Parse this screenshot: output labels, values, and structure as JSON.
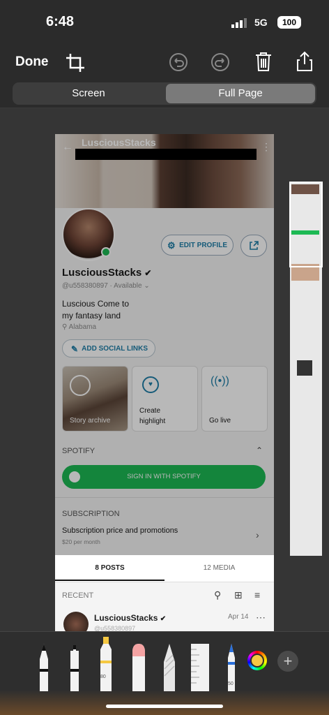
{
  "status": {
    "time": "6:48",
    "network": "5G",
    "battery": "100"
  },
  "toolbar": {
    "done_label": "Done"
  },
  "segment": {
    "screen_label": "Screen",
    "full_page_label": "Full Page"
  },
  "profile": {
    "top_name": "LusciousStacks",
    "edit_profile": "EDIT PROFILE",
    "display_name": "LusciousStacks",
    "handle": "@u558380897",
    "availability": "Available",
    "bio_line1": "Luscious Come to",
    "bio_line2": "my fantasy land",
    "location": "Alabama",
    "add_social": "ADD SOCIAL LINKS",
    "cards": [
      "Story archive",
      "Create highlight",
      "Go live"
    ],
    "spotify_header": "SPOTIFY",
    "spotify_button": "SIGN IN WITH SPOTIFY",
    "subscription_header": "SUBSCRIPTION",
    "subscription_title": "Subscription price and promotions",
    "subscription_price": "$20 per month"
  },
  "tabs": {
    "posts": "8 POSTS",
    "media": "12 MEDIA"
  },
  "feed": {
    "recent_label": "RECENT",
    "post_name": "LusciousStacks",
    "post_date": "Apr 14",
    "post_handle": "@u558380897"
  },
  "markup_tools": {
    "marker_level": "80",
    "pen_level": "50"
  },
  "colors": {
    "accent": "#1f7fa8",
    "spotify": "#1db954"
  }
}
